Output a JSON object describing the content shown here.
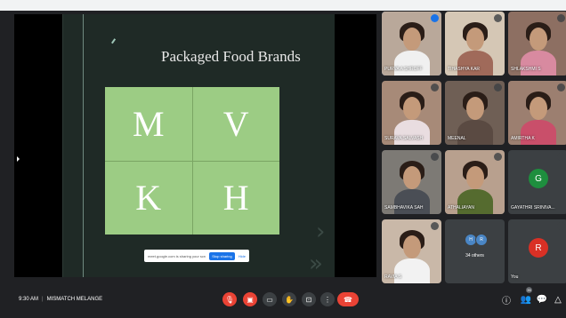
{
  "slide": {
    "title": "Packaged Food Brands",
    "letters": [
      "M",
      "V",
      "K",
      "H"
    ]
  },
  "share_bar": {
    "message": "meet.google.com is sharing your screen.",
    "stop_label": "Stop sharing",
    "hide_label": "Hide"
  },
  "participants": [
    {
      "name": "PURVA A SHROFF",
      "type": "video",
      "active": true,
      "bg": "#b9a89a",
      "shirt": "#f0f0f0"
    },
    {
      "name": "TIHASHYA KAR",
      "type": "video",
      "active": false,
      "bg": "#d5c7b5",
      "shirt": "#a06a5a"
    },
    {
      "name": "SHLAKSHMI S",
      "type": "video",
      "active": false,
      "bg": "#8d6f62",
      "shirt": "#d88aa0"
    },
    {
      "name": "SURAVA SALVASH",
      "type": "video",
      "active": false,
      "bg": "#a78a78",
      "shirt": "#e9dde0"
    },
    {
      "name": "MEENAL",
      "type": "video",
      "active": false,
      "bg": "#6f5f55",
      "shirt": "#5a4a42"
    },
    {
      "name": "AMIRTHA K",
      "type": "video",
      "active": false,
      "bg": "#9c7f70",
      "shirt": "#c94f6a"
    },
    {
      "name": "SAMBHAVIKA SAH",
      "type": "video",
      "active": false,
      "bg": "#7d7a75",
      "shirt": "#4a4e55"
    },
    {
      "name": "ATHALIAYAN",
      "type": "video",
      "active": false,
      "bg": "#b8a08e",
      "shirt": "#556b2f"
    },
    {
      "name": "GAYATHRI SRINIVA...",
      "type": "avatar",
      "initial": "G",
      "color": "#1e8e3e"
    },
    {
      "name": "RAVIA S",
      "type": "video",
      "active": false,
      "bg": "#c9b8a8",
      "shirt": "#f2f2f2"
    },
    {
      "name": "34 others",
      "type": "others",
      "initials": [
        "H",
        "R"
      ]
    },
    {
      "name": "You",
      "type": "avatar",
      "initial": "R",
      "color": "#d93025"
    }
  ],
  "bottom_bar": {
    "time": "9:30 AM",
    "meeting_name": "MISMATCH MELANGE",
    "participant_badge": "35"
  }
}
